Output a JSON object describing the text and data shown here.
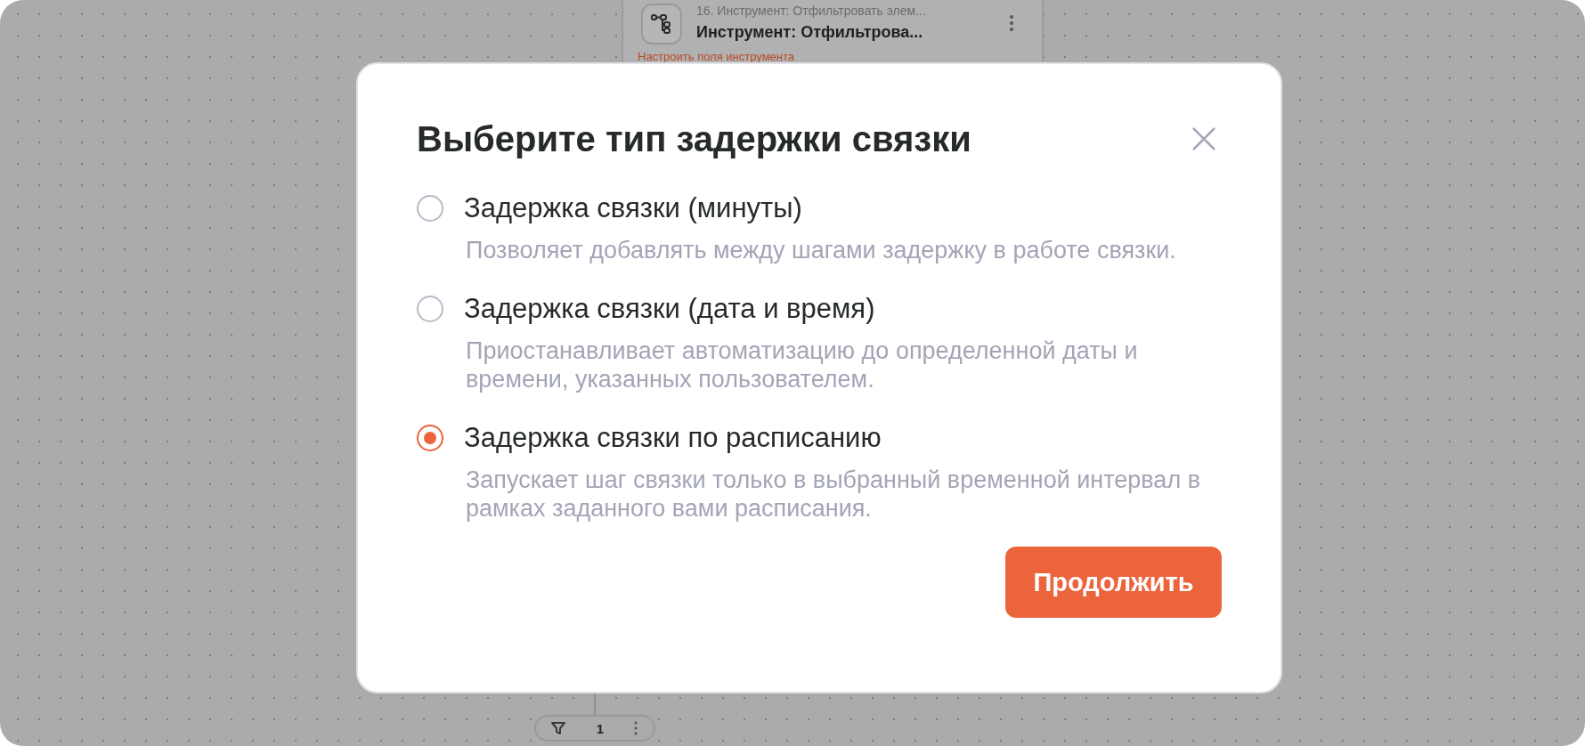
{
  "canvas": {
    "card": {
      "step": "16. Инструмент: Отфильтровать элем...",
      "title": "Инструмент: Отфильтрова...",
      "warning": "Настроить поля инструмента"
    },
    "filter_pill": {
      "count": "1"
    }
  },
  "dialog": {
    "title": "Выберите тип задержки связки",
    "options": [
      {
        "label": "Задержка связки (минуты)",
        "description": "Позволяет добавлять между шагами задержку в работе связки.",
        "selected": false
      },
      {
        "label": "Задержка связки (дата и время)",
        "description": "Приостанавливает автоматизацию до определенной даты и времени, указанных пользователем.",
        "selected": false
      },
      {
        "label": "Задержка связки по расписанию",
        "description": "Запускает шаг связки только в выбранный временной интервал в рамках заданного вами расписания.",
        "selected": true
      }
    ],
    "button": "Продолжить"
  }
}
